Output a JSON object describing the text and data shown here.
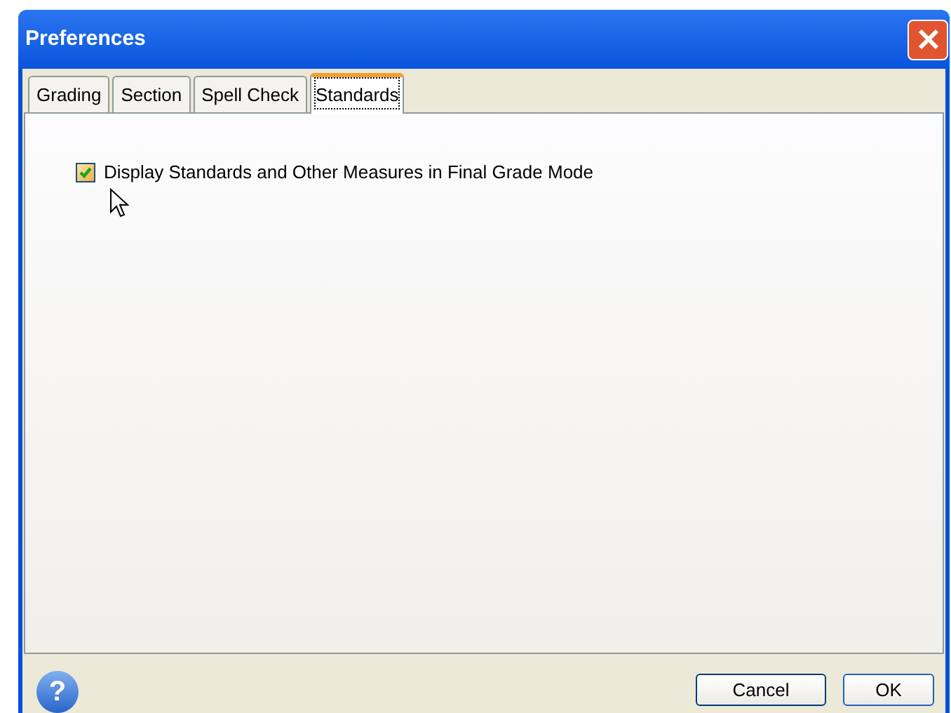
{
  "window": {
    "title": "Preferences"
  },
  "tabs": [
    {
      "label": "Grading",
      "selected": false
    },
    {
      "label": "Section",
      "selected": false
    },
    {
      "label": "Spell Check",
      "selected": false
    },
    {
      "label": "Standards",
      "selected": true
    }
  ],
  "options": [
    {
      "label": "Display Standards and Other Measures in Final Grade Mode",
      "checked": true
    }
  ],
  "help": "?",
  "buttons": [
    "Cancel",
    "OK"
  ]
}
